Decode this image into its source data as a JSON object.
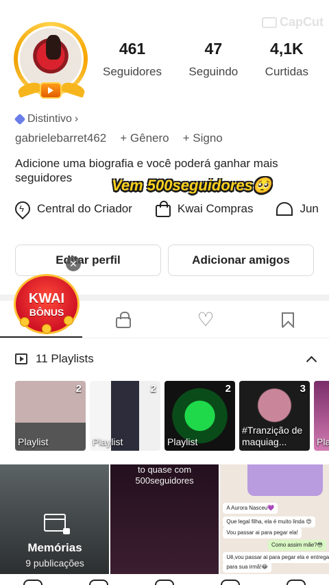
{
  "watermark": "CapCut",
  "stats": [
    {
      "value": "461",
      "label": "Seguidores"
    },
    {
      "value": "47",
      "label": "Seguindo"
    },
    {
      "value": "4,1K",
      "label": "Curtidas"
    }
  ],
  "badge_link": "Distintivo",
  "profile": {
    "username": "gabrielebarret462",
    "gender_link": "+ Gênero",
    "sign_link": "+ Signo",
    "bio": "Adicione uma biografia e você poderá ganhar mais seguidores",
    "sticker_text": "Vem 500seguidores🥺"
  },
  "quick_links": [
    {
      "label": "Central do Criador",
      "icon": "bolt-icon"
    },
    {
      "label": "Kwai Compras",
      "icon": "shopping-bag-icon"
    },
    {
      "label": "Jun",
      "icon": "tent-icon"
    }
  ],
  "buttons": {
    "edit": "Editar perfil",
    "add": "Adicionar amigos",
    "close": "✕"
  },
  "kwai_promo": {
    "line1": "KWAI",
    "line2": "BÔNUS"
  },
  "tabs": [
    "videos",
    "private",
    "liked",
    "saved"
  ],
  "playlists": {
    "header": "11 Playlists",
    "items": [
      {
        "count": "2",
        "title": "Playlist"
      },
      {
        "count": "2",
        "title": "Playlist"
      },
      {
        "count": "2",
        "title": "Playlist"
      },
      {
        "count": "3",
        "title": "#Tranzição de maquiag..."
      },
      {
        "count": "",
        "title": "Pla"
      }
    ]
  },
  "grid": {
    "memories_title": "Memórias",
    "memories_sub": "9 publicações",
    "cell2_caption": "to quase com\n500seguidores",
    "chat": [
      {
        "dir": "in",
        "text": "A Aurora Nasceu💜"
      },
      {
        "dir": "in",
        "text": "Que legal filha, ela é muito linda 😍"
      },
      {
        "dir": "in",
        "text": "Vou passar ai para pegar ela!"
      },
      {
        "dir": "out",
        "text": "Como assim mãe?😳"
      },
      {
        "dir": "in",
        "text": "Uê,vou passar ai para pegar ela e entregar"
      },
      {
        "dir": "in",
        "text": "para sua irmã!😂"
      }
    ]
  }
}
